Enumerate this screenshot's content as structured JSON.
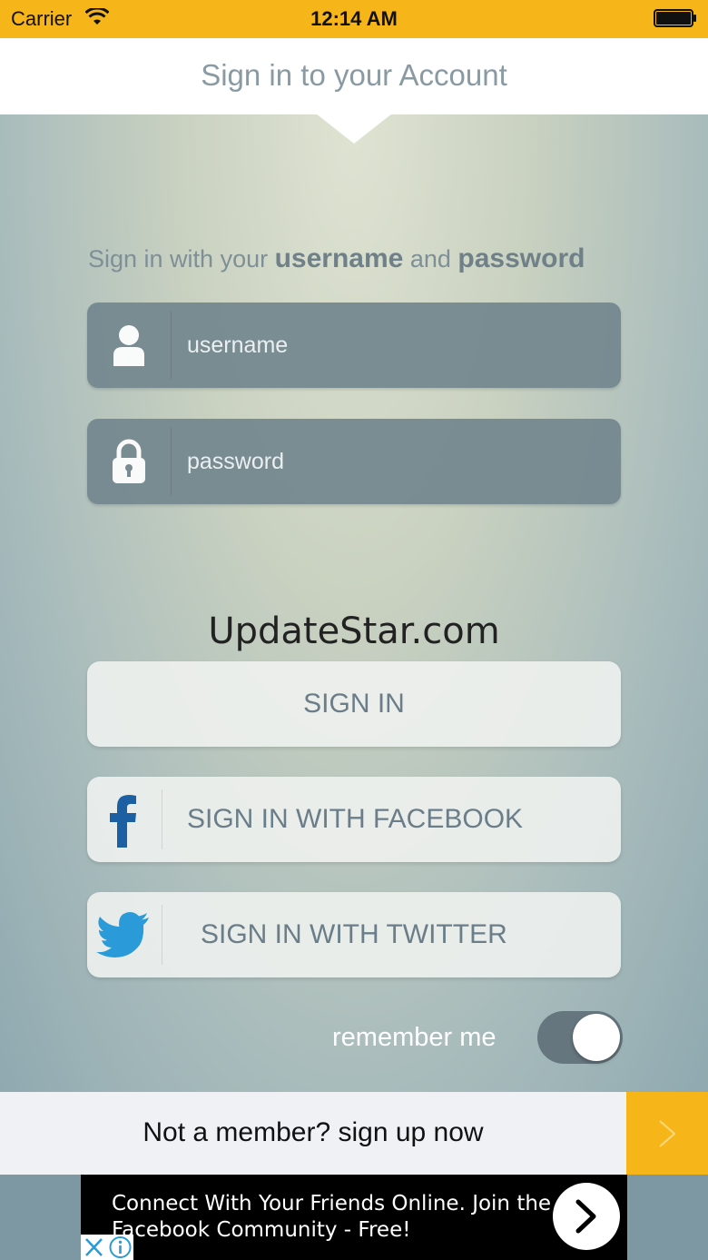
{
  "status_bar": {
    "carrier": "Carrier",
    "time": "12:14 AM",
    "wifi_icon": "wifi-icon",
    "battery_icon": "battery-icon"
  },
  "header": {
    "title": "Sign in to your Account"
  },
  "intro": {
    "prefix": "Sign in with your ",
    "username_word": "username",
    "middle": " and ",
    "password_word": "password"
  },
  "form": {
    "username_placeholder": "username",
    "password_placeholder": "password",
    "username_icon": "user-icon",
    "password_icon": "lock-icon"
  },
  "watermark": "UpdateStar.com",
  "buttons": {
    "sign_in": "SIGN IN",
    "facebook": "SIGN IN WITH FACEBOOK",
    "twitter": "SIGN IN WITH TWITTER"
  },
  "remember": {
    "label": "remember me",
    "enabled": true
  },
  "signup": {
    "text": "Not a member? sign up now"
  },
  "ad": {
    "text": "Connect With Your Friends Online. Join the Facebook Community - Free!"
  },
  "colors": {
    "accent": "#f6b518",
    "field": "#73878f",
    "facebook": "#1d5fa3",
    "twitter": "#2a9bd8"
  }
}
